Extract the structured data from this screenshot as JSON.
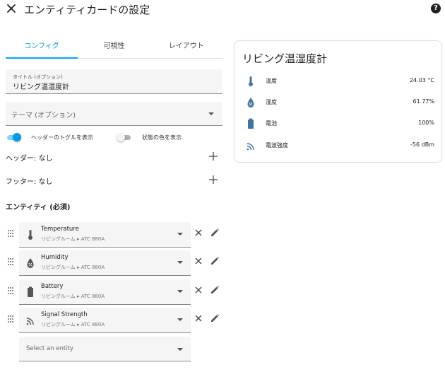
{
  "header": {
    "title": "エンティティカードの設定",
    "close_icon": "close-icon",
    "help_label": "?"
  },
  "tabs": [
    {
      "label": "コンフィグ",
      "active": true
    },
    {
      "label": "可視性",
      "active": false
    },
    {
      "label": "レイアウト",
      "active": false
    }
  ],
  "form": {
    "title_field": {
      "label": "タイトル (オプション)",
      "value": "リビング温湿度計"
    },
    "theme_field": {
      "placeholder": "テーマ (オプション)",
      "value": ""
    },
    "toggles": [
      {
        "label": "ヘッダーのトグルを表示",
        "on": true
      },
      {
        "label": "状態の色を表示",
        "on": false
      }
    ],
    "header_label": "ヘッダー: なし",
    "footer_label": "フッター: なし",
    "entities_heading": "エンティティ (必須)",
    "entities": [
      {
        "name": "Temperature",
        "sub": "リビングルーム ▸ ATC 880A",
        "icon": "thermometer-icon"
      },
      {
        "name": "Humidity",
        "sub": "リビングルーム ▸ ATC 880A",
        "icon": "water-percent-icon"
      },
      {
        "name": "Battery",
        "sub": "リビングルーム ▸ ATC 880A",
        "icon": "battery-icon"
      },
      {
        "name": "Signal Strength",
        "sub": "リビングルーム ▸ ATC 880A",
        "icon": "wifi-signal-icon"
      }
    ],
    "select_entity_placeholder": "Select an entity"
  },
  "preview": {
    "title": "リビング温湿度計",
    "rows": [
      {
        "name": "温度",
        "value": "24.03 °C",
        "icon": "thermometer-icon"
      },
      {
        "name": "湿度",
        "value": "61.77%",
        "icon": "water-percent-icon"
      },
      {
        "name": "電池",
        "value": "100%",
        "icon": "battery-icon"
      },
      {
        "name": "電波強度",
        "value": "-56 dBm",
        "icon": "wifi-signal-icon"
      }
    ]
  },
  "colors": {
    "accent": "#03a9f4",
    "toggle_on": "#039be5",
    "icon": "#44739e"
  }
}
